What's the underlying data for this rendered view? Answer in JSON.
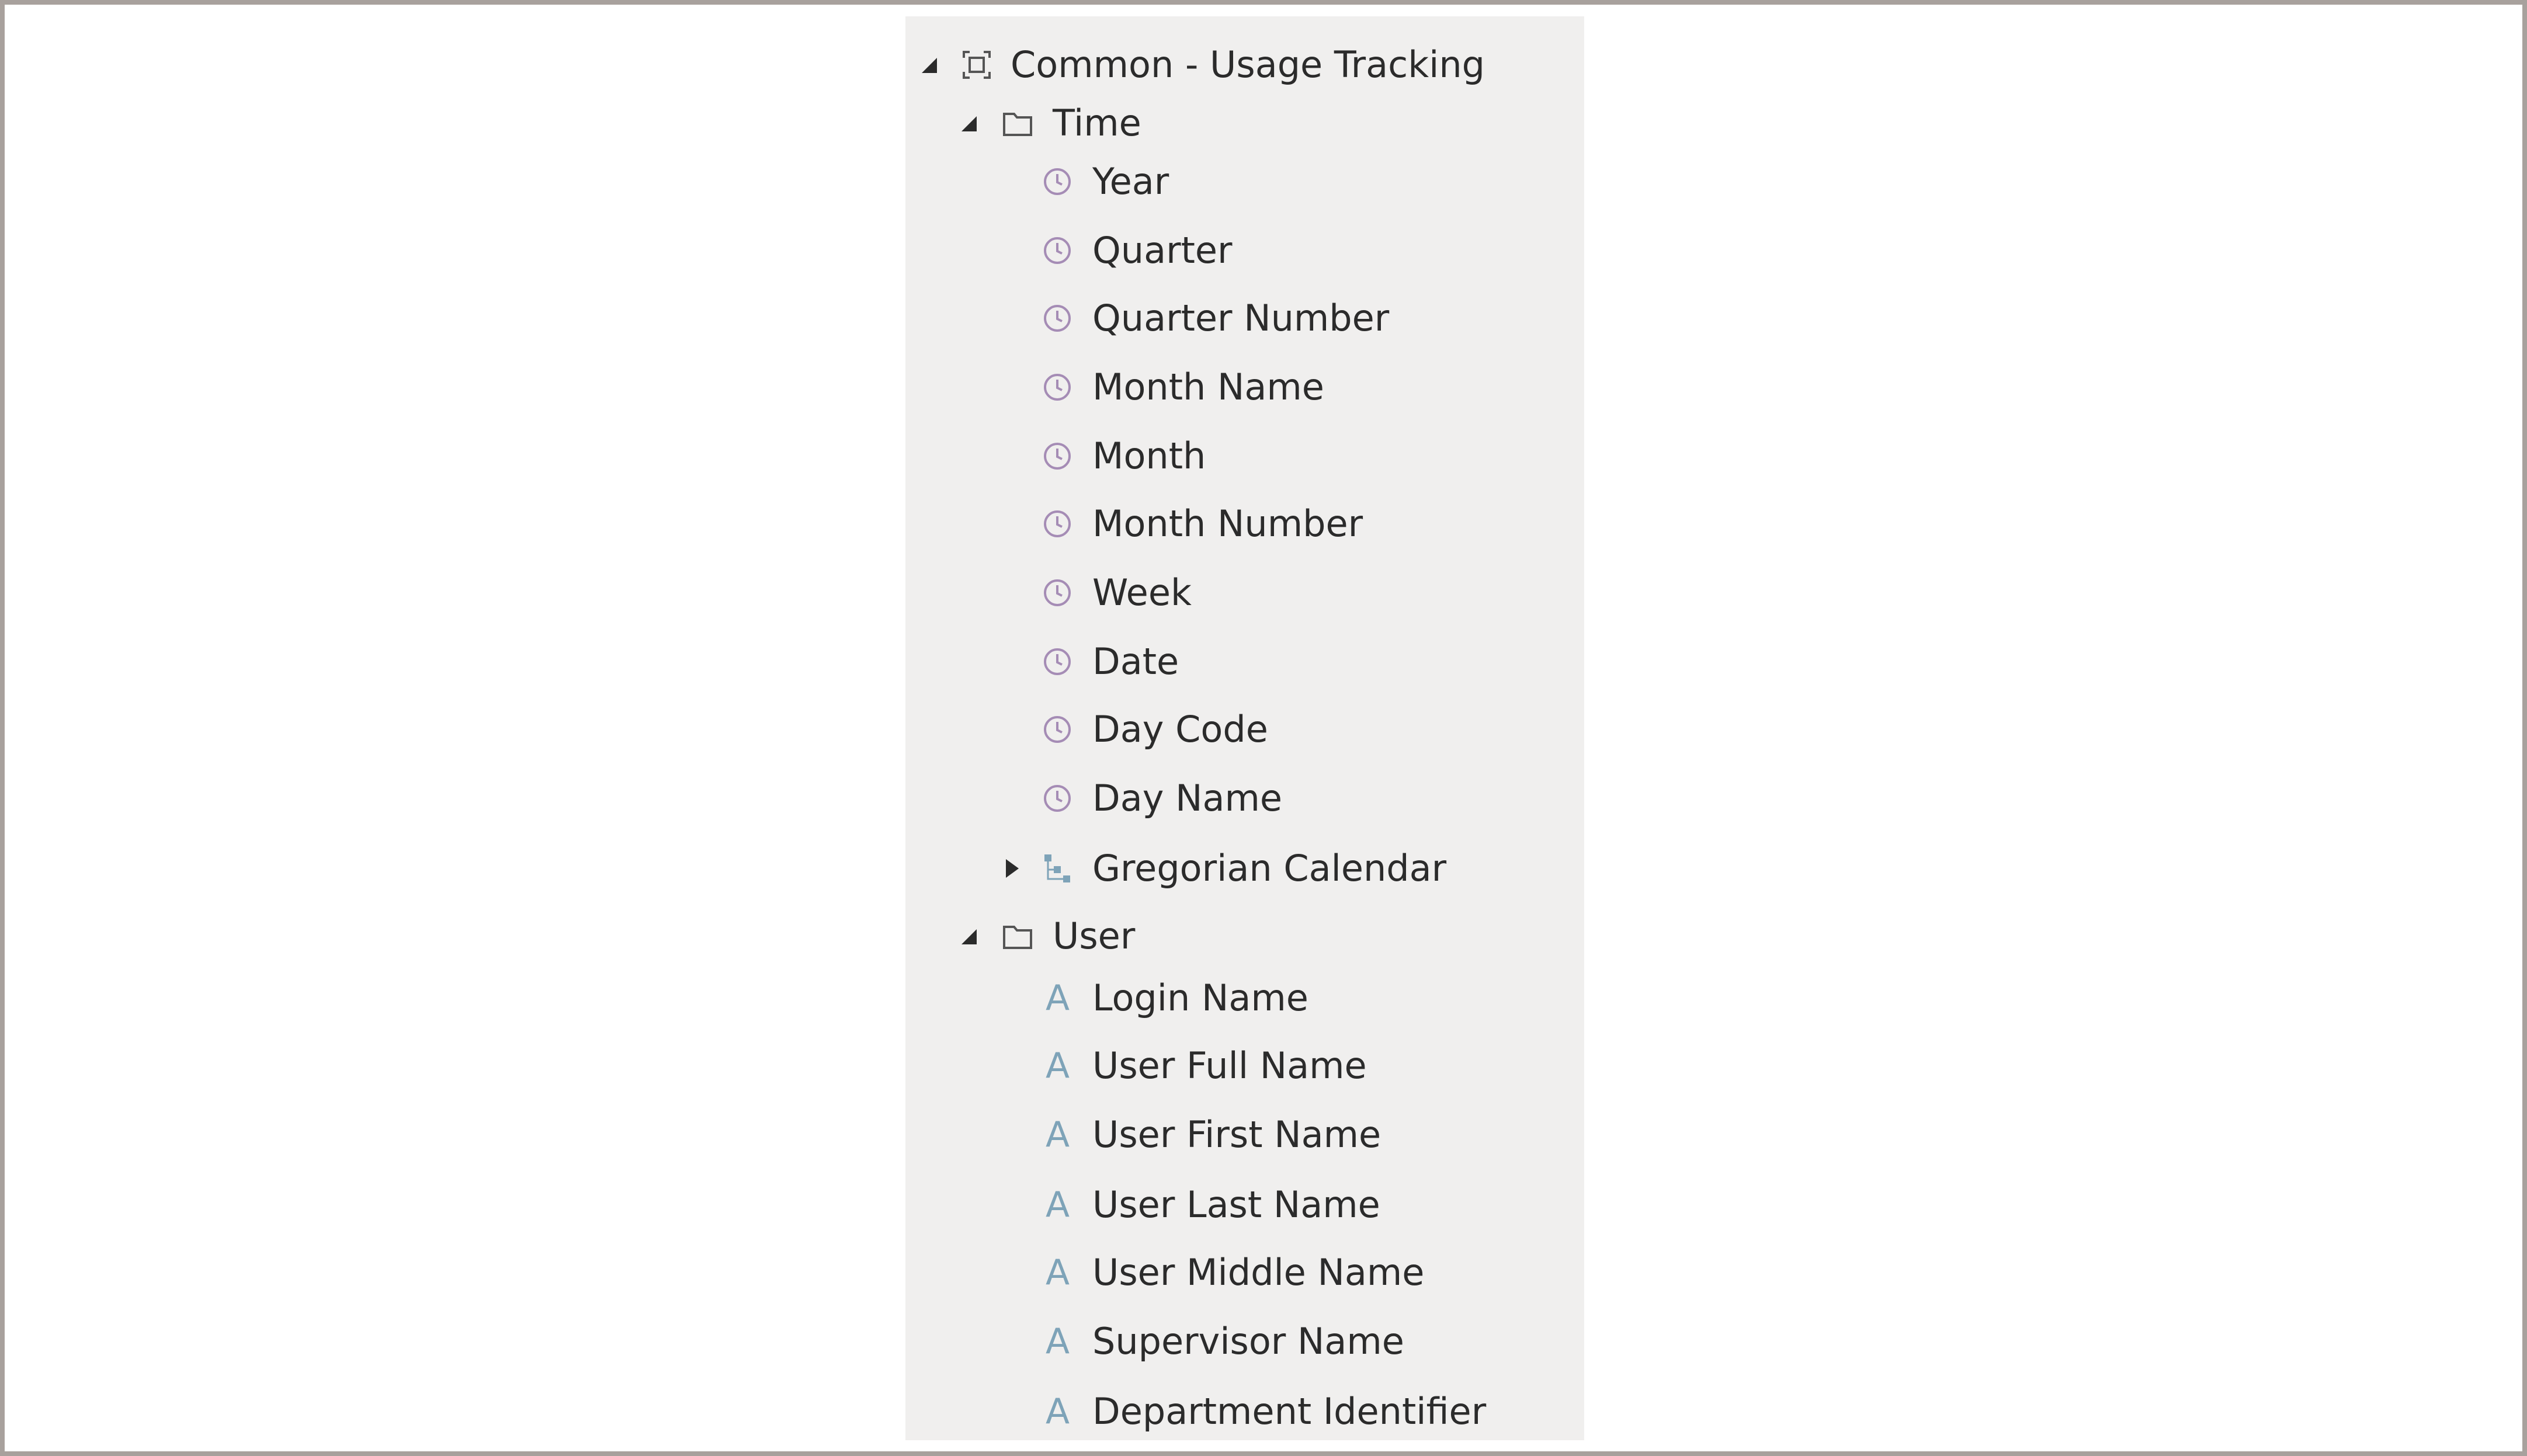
{
  "tree": {
    "root": {
      "label": "Common - Usage Tracking",
      "expanded": true,
      "icon": "subject-area-icon"
    },
    "folders": [
      {
        "label": "Time",
        "expanded": true,
        "icon": "folder-icon",
        "items": [
          {
            "label": "Year",
            "icon": "clock-icon"
          },
          {
            "label": "Quarter",
            "icon": "clock-icon"
          },
          {
            "label": "Quarter Number",
            "icon": "clock-icon"
          },
          {
            "label": "Month Name",
            "icon": "clock-icon"
          },
          {
            "label": "Month",
            "icon": "clock-icon"
          },
          {
            "label": "Month Number",
            "icon": "clock-icon"
          },
          {
            "label": "Week",
            "icon": "clock-icon"
          },
          {
            "label": "Date",
            "icon": "clock-icon"
          },
          {
            "label": "Day Code",
            "icon": "clock-icon"
          },
          {
            "label": "Day Name",
            "icon": "clock-icon"
          },
          {
            "label": "Gregorian Calendar",
            "icon": "hierarchy-icon",
            "expanded": false
          }
        ]
      },
      {
        "label": "User",
        "expanded": true,
        "icon": "folder-icon",
        "items": [
          {
            "label": "Login Name",
            "icon": "attribute-icon"
          },
          {
            "label": "User Full Name",
            "icon": "attribute-icon"
          },
          {
            "label": "User First Name",
            "icon": "attribute-icon"
          },
          {
            "label": "User Last Name",
            "icon": "attribute-icon"
          },
          {
            "label": "User Middle Name",
            "icon": "attribute-icon"
          },
          {
            "label": "Supervisor Name",
            "icon": "attribute-icon"
          },
          {
            "label": "Department Identifier",
            "icon": "attribute-icon"
          }
        ]
      }
    ],
    "attribute_glyph": "A"
  },
  "colors": {
    "panel_bg": "#f0efee",
    "text": "#2b2b2b",
    "clock_icon": "#a58cb5",
    "attribute_icon": "#7ea3b8",
    "hierarchy_icon": "#7ea3b8",
    "border": "#a8a19d"
  }
}
